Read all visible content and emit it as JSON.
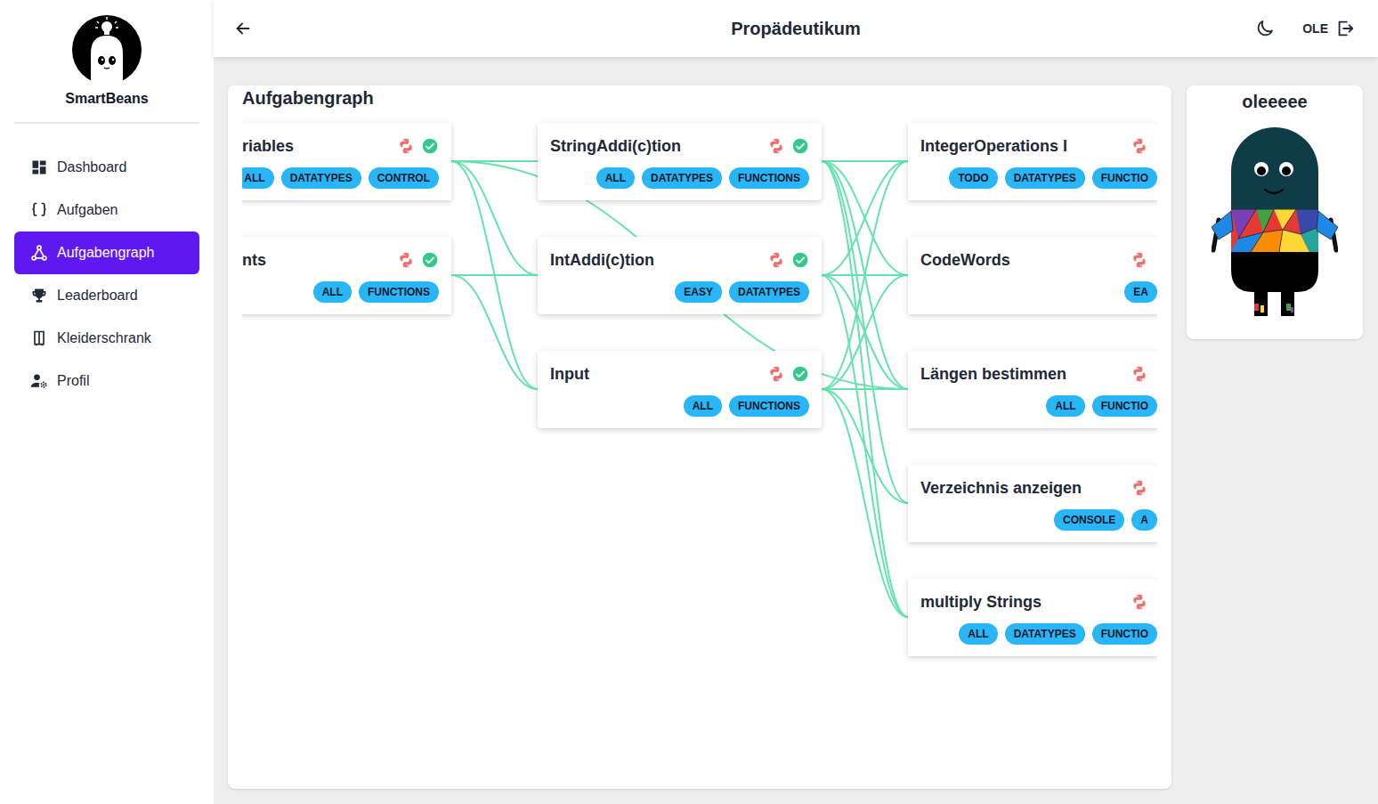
{
  "app": {
    "name": "SmartBeans"
  },
  "sidebar": {
    "items": [
      {
        "label": "Dashboard",
        "selected": false
      },
      {
        "label": "Aufgaben",
        "selected": false
      },
      {
        "label": "Aufgabengraph",
        "selected": true
      },
      {
        "label": "Leaderboard",
        "selected": false
      },
      {
        "label": "Kleiderschrank",
        "selected": false
      },
      {
        "label": "Profil",
        "selected": false
      }
    ]
  },
  "header": {
    "title": "Propädeutikum",
    "user": "OLE"
  },
  "graph": {
    "title": "Aufgabengraph",
    "columns": [
      {
        "nodes": [
          {
            "title": "riables",
            "tags": [
              "ALL",
              "DATATYPES",
              "CONTROL"
            ],
            "solved": true
          },
          {
            "title": "nts",
            "tags": [
              "ALL",
              "FUNCTIONS"
            ],
            "solved": true
          }
        ]
      },
      {
        "nodes": [
          {
            "title": "StringAddi(c)tion",
            "tags": [
              "ALL",
              "DATATYPES",
              "FUNCTIONS"
            ],
            "solved": true
          },
          {
            "title": "IntAddi(c)tion",
            "tags": [
              "EASY",
              "DATATYPES"
            ],
            "solved": true
          },
          {
            "title": "Input",
            "tags": [
              "ALL",
              "FUNCTIONS"
            ],
            "solved": true
          }
        ]
      },
      {
        "nodes": [
          {
            "title": "IntegerOperations I",
            "tags": [
              "TODO",
              "DATATYPES",
              "FUNCTIO"
            ],
            "solved": false
          },
          {
            "title": "CodeWords",
            "tags": [
              "EA"
            ],
            "solved": false
          },
          {
            "title": "Längen bestimmen",
            "tags": [
              "ALL",
              "FUNCTIO"
            ],
            "solved": false
          },
          {
            "title": "Verzeichnis anzeigen",
            "tags": [
              "CONSOLE",
              "A"
            ],
            "solved": false
          },
          {
            "title": "multiply Strings",
            "tags": [
              "ALL",
              "DATATYPES",
              "FUNCTIO"
            ],
            "solved": false
          }
        ]
      }
    ],
    "edges": [
      {
        "from": [
          0,
          0
        ],
        "to": [
          1,
          0
        ]
      },
      {
        "from": [
          0,
          0
        ],
        "to": [
          1,
          1
        ]
      },
      {
        "from": [
          0,
          0
        ],
        "to": [
          1,
          2
        ]
      },
      {
        "from": [
          0,
          0
        ],
        "to": [
          2,
          2
        ]
      },
      {
        "from": [
          0,
          1
        ],
        "to": [
          1,
          1
        ]
      },
      {
        "from": [
          0,
          1
        ],
        "to": [
          1,
          2
        ]
      },
      {
        "from": [
          1,
          0
        ],
        "to": [
          2,
          0
        ]
      },
      {
        "from": [
          1,
          0
        ],
        "to": [
          2,
          1
        ]
      },
      {
        "from": [
          1,
          0
        ],
        "to": [
          2,
          2
        ]
      },
      {
        "from": [
          1,
          0
        ],
        "to": [
          2,
          3
        ]
      },
      {
        "from": [
          1,
          0
        ],
        "to": [
          2,
          4
        ]
      },
      {
        "from": [
          1,
          1
        ],
        "to": [
          2,
          0
        ]
      },
      {
        "from": [
          1,
          1
        ],
        "to": [
          2,
          1
        ]
      },
      {
        "from": [
          1,
          1
        ],
        "to": [
          2,
          2
        ]
      },
      {
        "from": [
          1,
          1
        ],
        "to": [
          2,
          4
        ]
      },
      {
        "from": [
          1,
          2
        ],
        "to": [
          2,
          0
        ]
      },
      {
        "from": [
          1,
          2
        ],
        "to": [
          2,
          1
        ]
      },
      {
        "from": [
          1,
          2
        ],
        "to": [
          2,
          2
        ]
      },
      {
        "from": [
          1,
          2
        ],
        "to": [
          2,
          3
        ]
      },
      {
        "from": [
          1,
          2
        ],
        "to": [
          2,
          4
        ]
      }
    ]
  },
  "profile": {
    "name": "oleeeee"
  }
}
